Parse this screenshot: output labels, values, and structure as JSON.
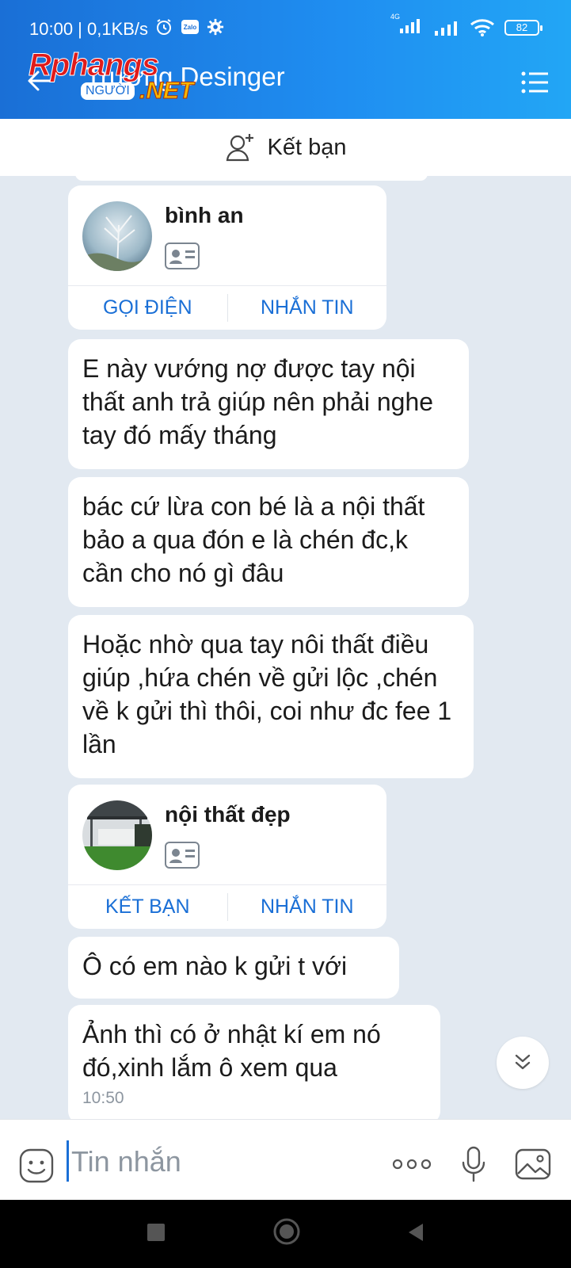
{
  "status_bar": {
    "time": "10:00 | 0,1KB/s",
    "zalo_badge": "Zalo",
    "network_badge": "4G",
    "battery": "82"
  },
  "header": {
    "title": "Trường Desinger",
    "watermark": {
      "main": "Rphangs",
      "sub": "NGƯỜI",
      "suffix": ".NET"
    }
  },
  "add_friend": {
    "label": "Kết bạn"
  },
  "messages": [
    {
      "type": "contact_card",
      "name": "bình an",
      "actions": [
        "GỌI ĐIỆN",
        "NHẮN TIN"
      ]
    },
    {
      "type": "text",
      "text": "E này vướng nợ được tay nội thất anh trả giúp nên phải nghe tay đó mấy tháng"
    },
    {
      "type": "text",
      "text": "bác cứ lừa con bé là a nội thất bảo a qua đón e là chén đc,k cần cho nó gì đâu"
    },
    {
      "type": "text",
      "text": "Hoặc nhờ qua tay nôi thất điều giúp ,hứa chén về gửi lộc ,chén về k gửi thì thôi, coi như đc fee 1 lần"
    },
    {
      "type": "contact_card",
      "name": "nội thất đẹp",
      "actions": [
        "KẾT BẠN",
        "NHẮN TIN"
      ]
    },
    {
      "type": "text",
      "text": "Ô có em nào k gửi t với"
    },
    {
      "type": "text",
      "text": "Ảnh thì có ở nhật kí em nó đó,xinh lắm ô xem qua",
      "time": "10:50"
    }
  ],
  "input_bar": {
    "placeholder": "Tin nhắn"
  },
  "colors": {
    "accent": "#1a6fd6",
    "chat_bg": "#e2e9f1",
    "bubble": "#ffffff"
  }
}
